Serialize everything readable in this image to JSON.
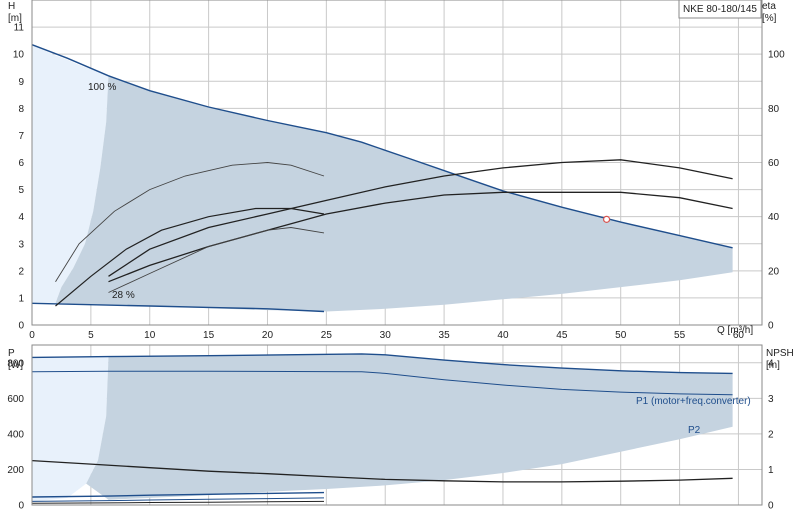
{
  "chart_data": [
    {
      "type": "line",
      "panel": "head",
      "title": "NKE 80-180/145",
      "xlabel": "Q [m³/h]",
      "ylabel": "H\n[m]",
      "y2label": "eta\n[%]",
      "xlim": [
        0,
        62
      ],
      "ylim": [
        0,
        12
      ],
      "y2lim": [
        0,
        120
      ],
      "xticks": [
        0,
        5,
        10,
        15,
        20,
        25,
        30,
        35,
        40,
        45,
        50,
        55,
        60
      ],
      "yticks": [
        0,
        1,
        2,
        3,
        4,
        5,
        6,
        7,
        8,
        9,
        10,
        11
      ],
      "y2ticks": [
        0,
        20,
        40,
        60,
        80,
        100
      ],
      "grid": true,
      "colors": {
        "curve": "#1f4e8c",
        "area": "#c5d3e0",
        "low_area": "#e8f1fb",
        "eta": "#222222"
      },
      "labels": {
        "max_speed": "100 %",
        "min_speed": "28 %"
      },
      "series": [
        {
          "role": "area_top",
          "x": [
            6.5,
            10,
            15,
            20,
            25,
            28,
            32,
            36,
            40,
            45,
            50,
            55,
            59.5
          ],
          "y": [
            9.2,
            8.65,
            8.05,
            7.55,
            7.1,
            6.75,
            6.15,
            5.55,
            4.95,
            4.35,
            3.8,
            3.3,
            2.85
          ]
        },
        {
          "role": "area_bottom",
          "x": [
            6.5,
            10,
            15,
            20,
            25,
            30,
            35,
            40,
            45,
            50,
            55,
            59.5
          ],
          "y": [
            0.75,
            0.7,
            0.62,
            0.55,
            0.5,
            0.6,
            0.75,
            0.95,
            1.15,
            1.4,
            1.65,
            1.95
          ]
        },
        {
          "role": "area_low_left",
          "x": [
            0,
            1,
            2,
            3,
            4,
            5,
            6.5
          ],
          "y": [
            10.35,
            10.15,
            9.95,
            9.8,
            9.6,
            9.45,
            9.2
          ]
        },
        {
          "role": "left_boundary",
          "x": [
            6.5,
            6.3,
            5.8,
            5.2,
            4.5,
            3.5,
            2.5,
            2.0
          ],
          "y": [
            9.2,
            7.5,
            5.8,
            4.2,
            3.0,
            2.1,
            1.4,
            0.8
          ]
        },
        {
          "role": "head_max",
          "x": [
            0,
            3,
            6.5,
            10,
            15,
            20,
            25,
            28,
            32,
            36,
            40,
            45,
            50,
            55,
            59.5
          ],
          "y": [
            10.35,
            9.85,
            9.2,
            8.65,
            8.05,
            7.55,
            7.1,
            6.75,
            6.15,
            5.55,
            4.95,
            4.35,
            3.8,
            3.3,
            2.85
          ]
        },
        {
          "role": "head_min",
          "x": [
            0,
            5,
            10,
            15,
            20,
            24.8
          ],
          "y": [
            0.8,
            0.75,
            0.7,
            0.65,
            0.6,
            0.5
          ]
        },
        {
          "role": "eta_max",
          "x": [
            6.5,
            10,
            15,
            20,
            25,
            30,
            35,
            40,
            45,
            50,
            55,
            59.5
          ],
          "y2": [
            18,
            28,
            36,
            41,
            46,
            51,
            55,
            58,
            60,
            61,
            58,
            54
          ]
        },
        {
          "role": "eta_mid",
          "x": [
            2,
            5,
            8,
            11,
            15,
            19,
            22,
            24.8
          ],
          "y2": [
            7,
            18,
            28,
            35,
            40,
            43,
            43,
            41
          ]
        },
        {
          "role": "eta_low",
          "x": [
            6.5,
            10,
            15,
            20,
            25,
            30,
            35,
            40,
            45,
            50,
            55,
            59.5
          ],
          "y2": [
            16,
            22,
            29,
            35,
            41,
            45,
            48,
            49,
            49,
            49,
            47,
            43
          ]
        },
        {
          "role": "eta_top_small",
          "x": [
            2,
            4,
            7,
            10,
            13,
            17,
            20,
            22,
            24.8
          ],
          "y2": [
            16,
            30,
            42,
            50,
            55,
            59,
            60,
            59,
            55
          ]
        },
        {
          "role": "eta_28",
          "x": [
            6.5,
            10,
            15,
            20,
            22,
            24.8
          ],
          "y2": [
            12,
            19,
            29,
            35,
            36,
            34
          ]
        },
        {
          "role": "duty_point",
          "x": [
            48.8
          ],
          "y": [
            3.9
          ]
        }
      ]
    },
    {
      "type": "line",
      "panel": "power",
      "ylabel": "P\n[W]",
      "y2label": "NPSH\n[m]",
      "xlim": [
        0,
        62
      ],
      "ylim": [
        0,
        900
      ],
      "y2lim": [
        0,
        4.5
      ],
      "yticks": [
        0,
        200,
        400,
        600,
        800
      ],
      "y2ticks": [
        0,
        1,
        2,
        3,
        4
      ],
      "grid": true,
      "labels": {
        "p1": "P1 (motor+freq.converter)",
        "p2": "P2"
      },
      "series": [
        {
          "role": "p1",
          "x": [
            0,
            6.5,
            15,
            28,
            30,
            35,
            40,
            45,
            50,
            55,
            59.5
          ],
          "y": [
            830,
            835,
            840,
            850,
            845,
            815,
            790,
            770,
            755,
            745,
            740
          ]
        },
        {
          "role": "p2",
          "x": [
            0,
            6.5,
            15,
            28,
            30,
            35,
            40,
            45,
            50,
            55,
            59.5
          ],
          "y": [
            750,
            752,
            752,
            750,
            740,
            705,
            675,
            650,
            635,
            625,
            620
          ]
        },
        {
          "role": "area_bottom",
          "x": [
            6.5,
            10,
            15,
            20,
            25,
            30,
            35,
            40,
            45,
            50,
            55,
            59.5
          ],
          "y": [
            30,
            40,
            55,
            75,
            90,
            110,
            140,
            180,
            230,
            300,
            370,
            440
          ]
        },
        {
          "role": "npsh",
          "x": [
            0,
            5,
            10,
            15,
            20,
            25,
            30,
            35,
            40,
            45,
            50,
            55,
            59.5
          ],
          "y2": [
            1.25,
            1.15,
            1.05,
            0.95,
            0.88,
            0.8,
            0.72,
            0.68,
            0.65,
            0.65,
            0.67,
            0.7,
            0.75
          ]
        },
        {
          "role": "p_low1",
          "x": [
            0,
            6.5,
            10,
            15,
            20,
            24.8
          ],
          "y": [
            45,
            50,
            55,
            60,
            65,
            70
          ]
        },
        {
          "role": "p_low2",
          "x": [
            0,
            6.5,
            10,
            15,
            20,
            24.8
          ],
          "y": [
            20,
            25,
            28,
            32,
            36,
            40
          ]
        },
        {
          "role": "p_low3",
          "x": [
            0,
            6.5,
            10,
            15,
            20,
            24.8
          ],
          "y": [
            10,
            12,
            14,
            16,
            18,
            20
          ]
        }
      ]
    }
  ]
}
